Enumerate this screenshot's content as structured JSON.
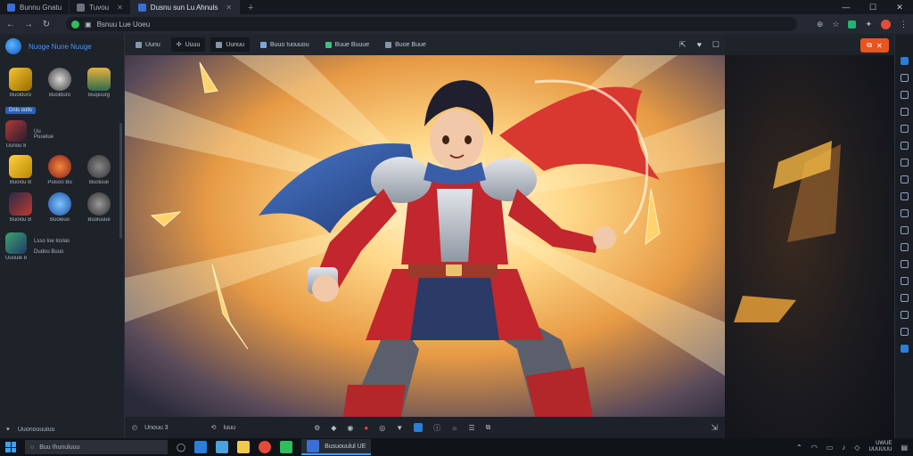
{
  "browser": {
    "tabs": [
      {
        "label": "Bunnu Gnatu"
      },
      {
        "label": "Tuvou"
      },
      {
        "label": "Dusnu sun Lu Ahnuls"
      }
    ],
    "address": "Bsnuu Lue Uoeu"
  },
  "sidebar": {
    "brand": "Nuoge Nune Nuuge",
    "top_games": [
      "Buolduro",
      "Buolduro",
      "Buqiuurg"
    ],
    "section_label": "Dnls oolls",
    "list_item_title": "Uu",
    "list_item_sub": "Puuelue",
    "list_item_caption": "Uunou 8",
    "games_row1": [
      "Buolou B",
      "Puisoo Bu",
      "Buoluue"
    ],
    "games_row2": [
      "Buolou B",
      "Buoleuo",
      "Buoluuue"
    ],
    "list2_title": "Lsso Ioe Ioslas",
    "list2_sub": "Dudou Buuo",
    "list2_caption": "Uuoule 8",
    "footer": "Uuonouuuiuu"
  },
  "viewer": {
    "toolbar": [
      "Uunu",
      "Uuuu",
      "Uunuu",
      "Buuo Iuouuou",
      "Buue Buuue",
      "Buoe Buue"
    ],
    "bottom_left": "Unouu 3",
    "bottom_right": "Iuuu"
  },
  "taskbar": {
    "search": "Buu Ihunuluuu",
    "active_app": "Busuouulul UE",
    "time": "UWUE",
    "date": "UUUUUU"
  },
  "colors": {
    "accent": "#2b7fd9",
    "share": "#e8551f",
    "brand": "#4c93ff"
  }
}
